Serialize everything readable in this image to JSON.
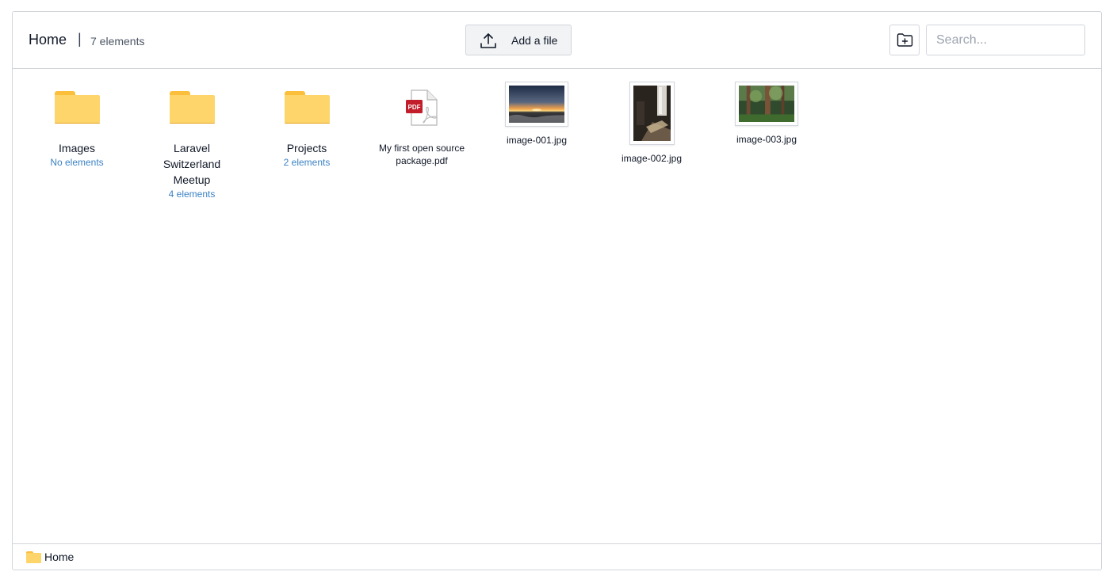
{
  "header": {
    "title": "Home",
    "separator": "|",
    "count": "7 elements",
    "upload_label": "Add a file",
    "upload_icon": "upload-icon",
    "new_folder_icon": "folder-plus-icon",
    "search_placeholder": "Search..."
  },
  "items": [
    {
      "kind": "folder",
      "name": "Images",
      "sub": "No elements"
    },
    {
      "kind": "folder",
      "name": "Laravel Switzerland Meetup",
      "sub": "4 elements"
    },
    {
      "kind": "folder",
      "name": "Projects",
      "sub": "2 elements"
    },
    {
      "kind": "pdf",
      "name": "My first open source package.pdf",
      "badge": "PDF"
    },
    {
      "kind": "image",
      "name": "image-001.jpg"
    },
    {
      "kind": "image",
      "name": "image-002.jpg"
    },
    {
      "kind": "image",
      "name": "image-003.jpg"
    }
  ],
  "breadcrumb": {
    "icon": "folder-icon",
    "label": "Home"
  },
  "colors": {
    "folder": "#fdd56b",
    "folder_tab": "#fbbf3b",
    "link": "#3b82c4",
    "pdf_badge": "#c21d2a"
  }
}
